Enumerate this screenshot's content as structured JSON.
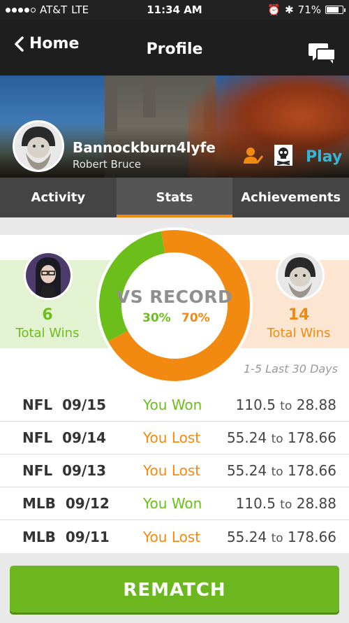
{
  "status_bar": {
    "carrier": "AT&T",
    "network": "LTE",
    "time": "11:34 AM",
    "battery": "71%"
  },
  "nav": {
    "back_label": "Home",
    "title": "Profile"
  },
  "profile": {
    "username": "Bannockburn4lyfe",
    "real_name": "Robert Bruce",
    "play_label": "Play"
  },
  "tabs": [
    {
      "label": "Activity"
    },
    {
      "label": "Stats",
      "active": true
    },
    {
      "label": "Achievements"
    }
  ],
  "record": {
    "title": "VS RECORD",
    "left": {
      "wins": "6",
      "label": "Total Wins",
      "pct": "30%"
    },
    "right": {
      "wins": "14",
      "label": "Total Wins",
      "pct": "70%"
    },
    "donut": {
      "left_fraction": 0.3,
      "right_fraction": 0.7,
      "left_color": "#6cbf1a",
      "right_color": "#f28a12"
    }
  },
  "period": "1-5 Last 30 Days",
  "games": [
    {
      "league": "NFL",
      "date": "09/15",
      "result": "You Won",
      "won": true,
      "score_a": "110.5",
      "score_b": "28.88"
    },
    {
      "league": "NFL",
      "date": "09/14",
      "result": "You Lost",
      "won": false,
      "score_a": "55.24",
      "score_b": "178.66"
    },
    {
      "league": "NFL",
      "date": "09/13",
      "result": "You Lost",
      "won": false,
      "score_a": "55.24",
      "score_b": "178.66"
    },
    {
      "league": "MLB",
      "date": "09/12",
      "result": "You Won",
      "won": true,
      "score_a": "110.5",
      "score_b": "28.88"
    },
    {
      "league": "MLB",
      "date": "09/11",
      "result": "You Lost",
      "won": false,
      "score_a": "55.24",
      "score_b": "178.66"
    }
  ],
  "score_joiner": "to",
  "rematch_label": "REMATCH",
  "colors": {
    "accent_orange": "#f28a12",
    "accent_green": "#6cbf1a",
    "play_blue": "#35b6d8"
  }
}
